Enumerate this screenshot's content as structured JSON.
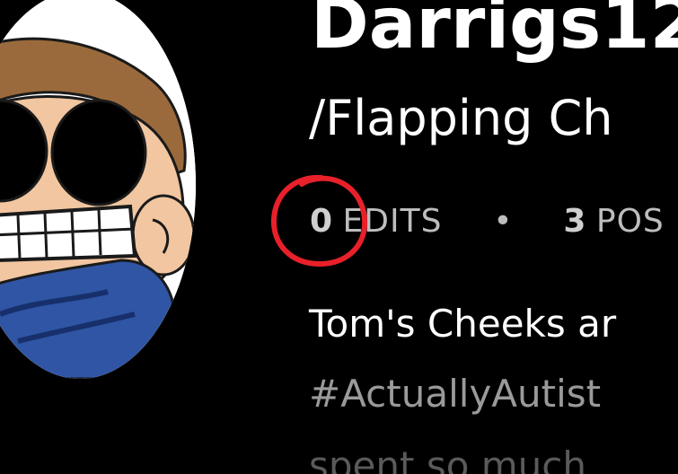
{
  "profile": {
    "username": "Darrigs12",
    "community": "/Flapping Ch",
    "stats": {
      "edits_count": "0",
      "edits_label": "EDITS",
      "separator": "•",
      "posts_count": "3",
      "posts_label": "POS"
    },
    "bio": {
      "line1": "Tom's Cheeks ar",
      "line2": "#ActuallyAutist",
      "line3": "spent so much"
    }
  },
  "colors": {
    "background": "#000000",
    "title": "#ffffff",
    "stats_text": "#bdbdbd",
    "hashtag_text": "#9a9a9a",
    "annotation_circle": "#e8202a"
  }
}
